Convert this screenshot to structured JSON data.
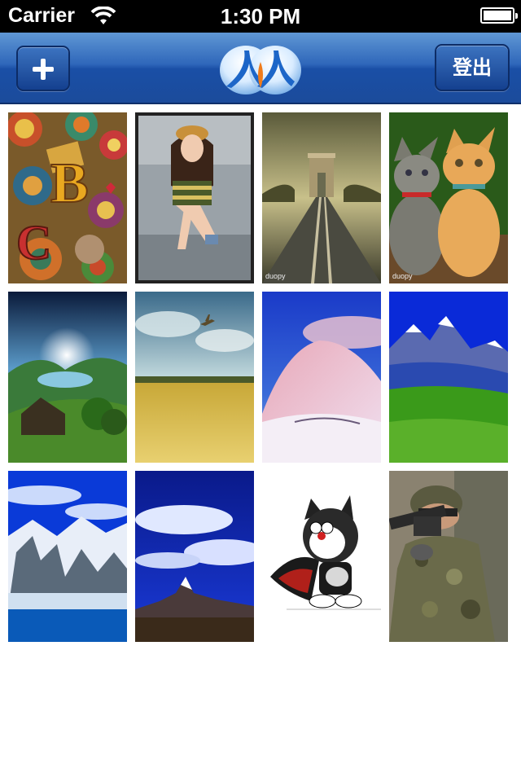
{
  "status_bar": {
    "carrier": "Carrier",
    "time": "1:30 PM"
  },
  "nav_bar": {
    "add_icon": "plus-icon",
    "logo": "renren-logo",
    "logout_label": "登出"
  },
  "photos": [
    {
      "subject": "abstract-letters-art",
      "watermark": ""
    },
    {
      "subject": "girl-in-striped-top",
      "watermark": ""
    },
    {
      "subject": "arc-de-triomphe-road",
      "watermark": "duopy"
    },
    {
      "subject": "two-kittens",
      "watermark": "duopy"
    },
    {
      "subject": "sunlit-valley-cabin",
      "watermark": ""
    },
    {
      "subject": "wheat-field-plane",
      "watermark": ""
    },
    {
      "subject": "pink-snowy-hill",
      "watermark": ""
    },
    {
      "subject": "snowy-mountain-meadow",
      "watermark": ""
    },
    {
      "subject": "glacier-mountains",
      "watermark": ""
    },
    {
      "subject": "matterhorn-clouds",
      "watermark": ""
    },
    {
      "subject": "doraemon-cape",
      "watermark": ""
    },
    {
      "subject": "soldier-aiming-rifle",
      "watermark": ""
    }
  ]
}
